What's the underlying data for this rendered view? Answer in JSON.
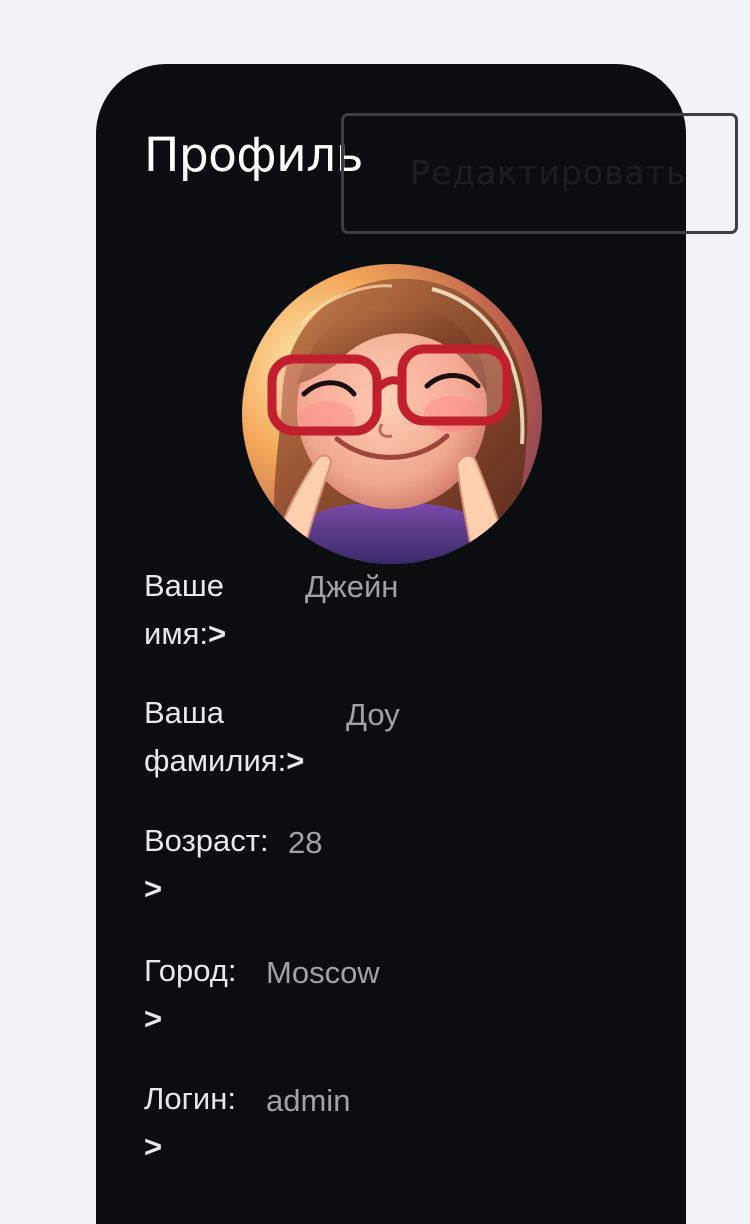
{
  "profile": {
    "title": "Профиль",
    "edit_label": "Редактировать",
    "chevron": ">",
    "fields": [
      {
        "label_line1": "Ваше",
        "label_line2": "имя:",
        "value": "Джейн"
      },
      {
        "label_line1": "Ваша",
        "label_line2": "фамилия:",
        "value": "Доу"
      },
      {
        "label_line1": "Возраст:",
        "label_line2": "",
        "value": "28"
      },
      {
        "label_line1": "Город:",
        "label_line2": "",
        "value": "Moscow"
      },
      {
        "label_line1": "Логин:",
        "label_line2": "",
        "value": "admin"
      }
    ]
  },
  "colors": {
    "page_background": "#f0f4f8",
    "card_background": "#0a0e11",
    "label_text": "#e6e8ea",
    "value_text": "#9da3a8",
    "button_border": "#3b4045"
  },
  "icons": {
    "avatar": "cartoon-girl-with-red-glasses-avatar",
    "chevron": "chevron-right-icon"
  }
}
